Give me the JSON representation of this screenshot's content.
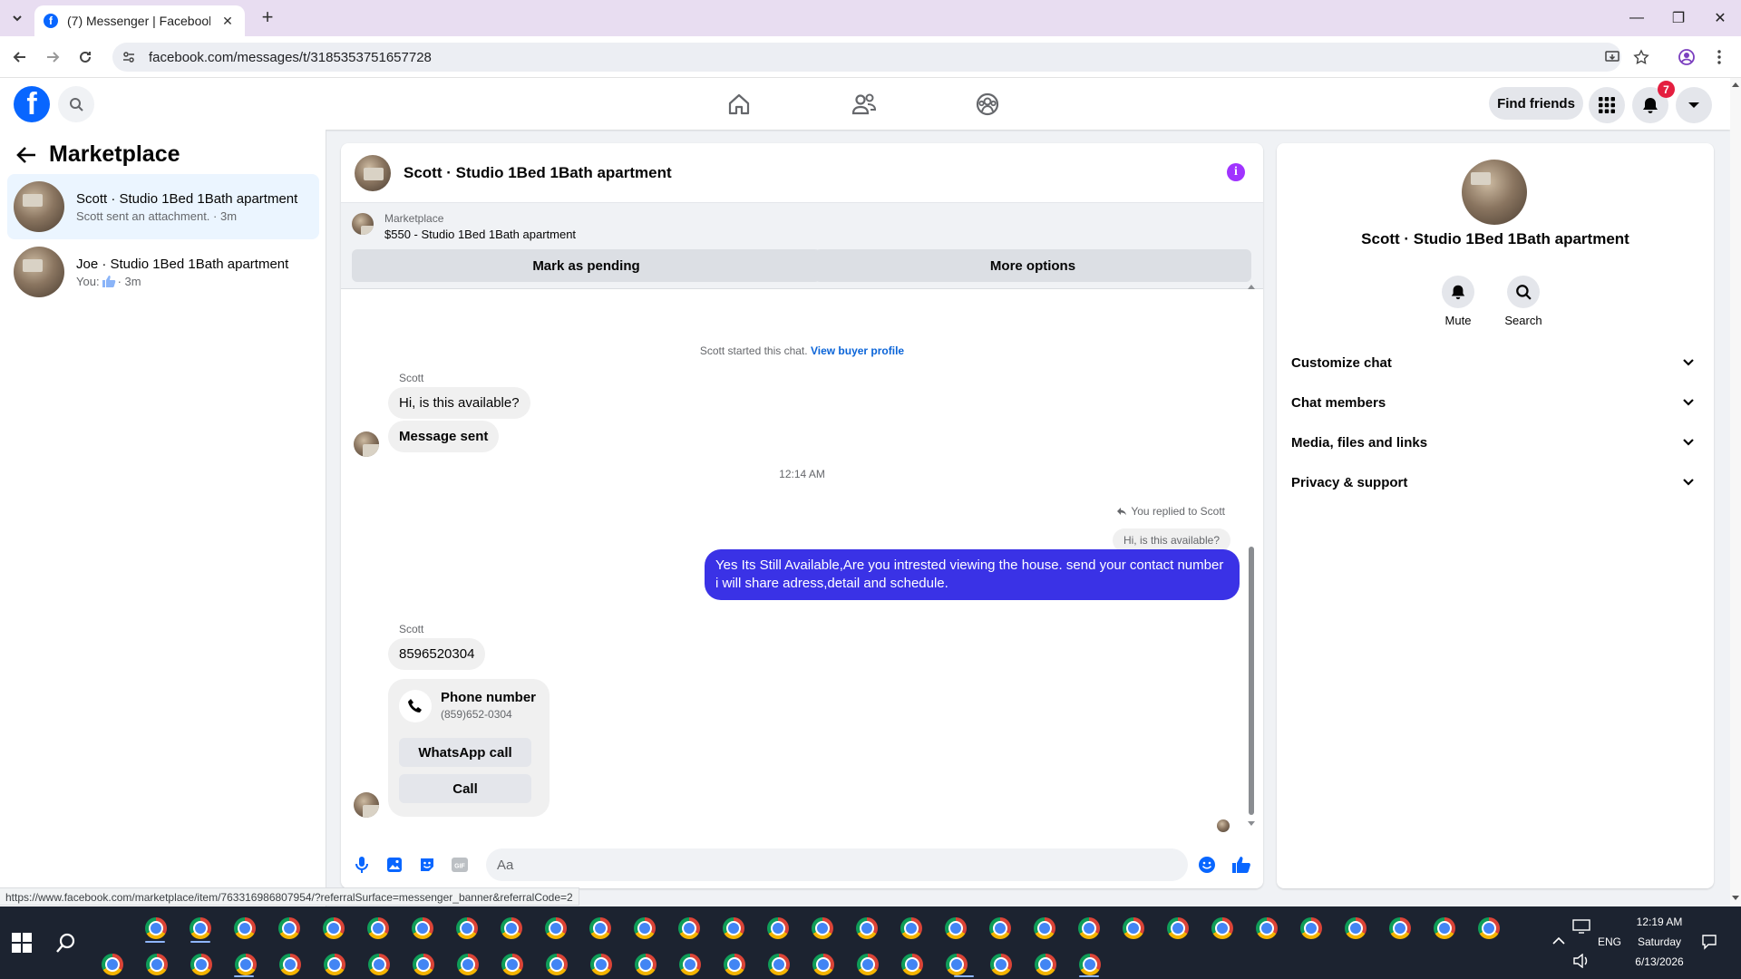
{
  "browser": {
    "tab_title": "(7) Messenger | Facebook",
    "url": "facebook.com/messages/t/3185353751657728",
    "status_url": "https://www.facebook.com/marketplace/item/763316986807954/?referralSurface=messenger_banner&referralCode=2"
  },
  "header": {
    "find_friends": "Find friends",
    "notification_count": "7",
    "brand_color": "#0866ff"
  },
  "sidebar": {
    "title": "Marketplace",
    "conversations": [
      {
        "name": "Scott · Studio 1Bed 1Bath apartment",
        "preview": "Scott sent an attachment. · 3m",
        "active": true
      },
      {
        "name": "Joe · Studio 1Bed 1Bath apartment",
        "preview_prefix": "You:",
        "preview_icon": "thumbs-up-icon",
        "preview_suffix": " · 3m",
        "active": false
      }
    ]
  },
  "chat": {
    "title": "Scott · Studio 1Bed 1Bath apartment",
    "banner": {
      "label": "Marketplace",
      "listing": "$550 - Studio 1Bed 1Bath apartment",
      "mark_pending": "Mark as pending",
      "more_options": "More options"
    },
    "started_text": "Scott started this chat.",
    "view_buyer_profile": "View buyer profile",
    "sender_1": "Scott",
    "msg_1": "Hi, is this available?",
    "msg_2": "Message sent",
    "timestamp": "12:14 AM",
    "replied_to": "You replied to Scott",
    "reply_quote": "Hi, is this available?",
    "outgoing": "Yes Its Still Available,Are you intrested viewing the house. send your contact number i will share adress,detail and schedule.",
    "sender_2": "Scott",
    "msg_3": "8596520304",
    "phone_card": {
      "title": "Phone number",
      "number": "(859)652-0304",
      "whatsapp": "WhatsApp call",
      "call": "Call"
    },
    "composer_placeholder": "Aa",
    "outgoing_color": "#3a32e6"
  },
  "info_panel": {
    "name": "Scott · Studio 1Bed 1Bath apartment",
    "mute": "Mute",
    "search": "Search",
    "sections": [
      "Customize chat",
      "Chat members",
      "Media, files and links",
      "Privacy & support"
    ]
  },
  "taskbar": {
    "language": "ENG",
    "time": "12:19 AM",
    "day": "Saturday",
    "date": "6/13/2026"
  }
}
